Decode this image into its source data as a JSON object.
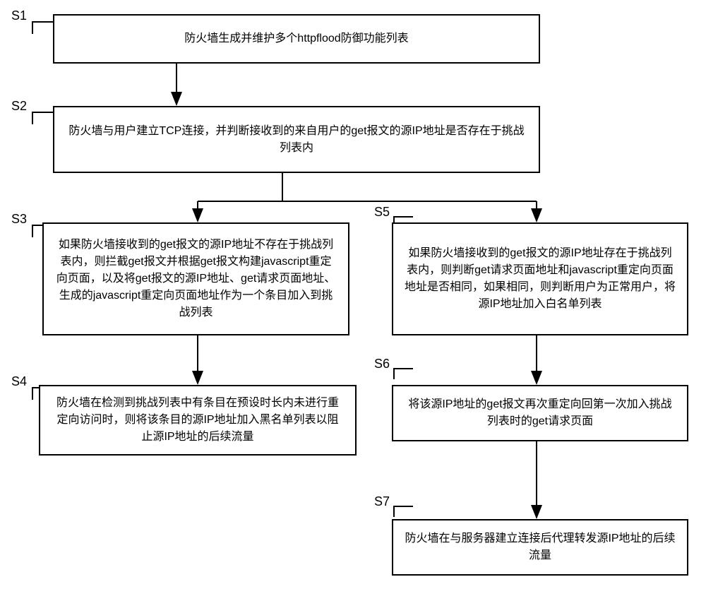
{
  "labels": {
    "s1": "S1",
    "s2": "S2",
    "s3": "S3",
    "s4": "S4",
    "s5": "S5",
    "s6": "S6",
    "s7": "S7"
  },
  "steps": {
    "s1": "防火墙生成并维护多个httpflood防御功能列表",
    "s2": "防火墙与用户建立TCP连接，并判断接收到的来自用户的get报文的源IP地址是否存在于挑战列表内",
    "s3": "如果防火墙接收到的get报文的源IP地址不存在于挑战列表内，则拦截get报文并根据get报文构建javascript重定向页面，以及将get报文的源IP地址、get请求页面地址、生成的javascript重定向页面地址作为一个条目加入到挑战列表",
    "s4": "防火墙在检测到挑战列表中有条目在预设时长内未进行重定向访问时，则将该条目的源IP地址加入黑名单列表以阻止源IP地址的后续流量",
    "s5": "如果防火墙接收到的get报文的源IP地址存在于挑战列表内，则判断get请求页面地址和javascript重定向页面地址是否相同，如果相同，则判断用户为正常用户，将源IP地址加入白名单列表",
    "s6": "将该源IP地址的get报文再次重定向回第一次加入挑战列表时的get请求页面",
    "s7": "防火墙在与服务器建立连接后代理转发源IP地址的后续流量"
  },
  "chart_data": {
    "type": "flowchart",
    "nodes": [
      {
        "id": "S1",
        "text_key": "steps.s1"
      },
      {
        "id": "S2",
        "text_key": "steps.s2"
      },
      {
        "id": "S3",
        "text_key": "steps.s3"
      },
      {
        "id": "S4",
        "text_key": "steps.s4"
      },
      {
        "id": "S5",
        "text_key": "steps.s5"
      },
      {
        "id": "S6",
        "text_key": "steps.s6"
      },
      {
        "id": "S7",
        "text_key": "steps.s7"
      }
    ],
    "edges": [
      {
        "from": "S1",
        "to": "S2"
      },
      {
        "from": "S2",
        "to": "S3"
      },
      {
        "from": "S2",
        "to": "S5"
      },
      {
        "from": "S3",
        "to": "S4"
      },
      {
        "from": "S5",
        "to": "S6"
      },
      {
        "from": "S6",
        "to": "S7"
      }
    ]
  }
}
